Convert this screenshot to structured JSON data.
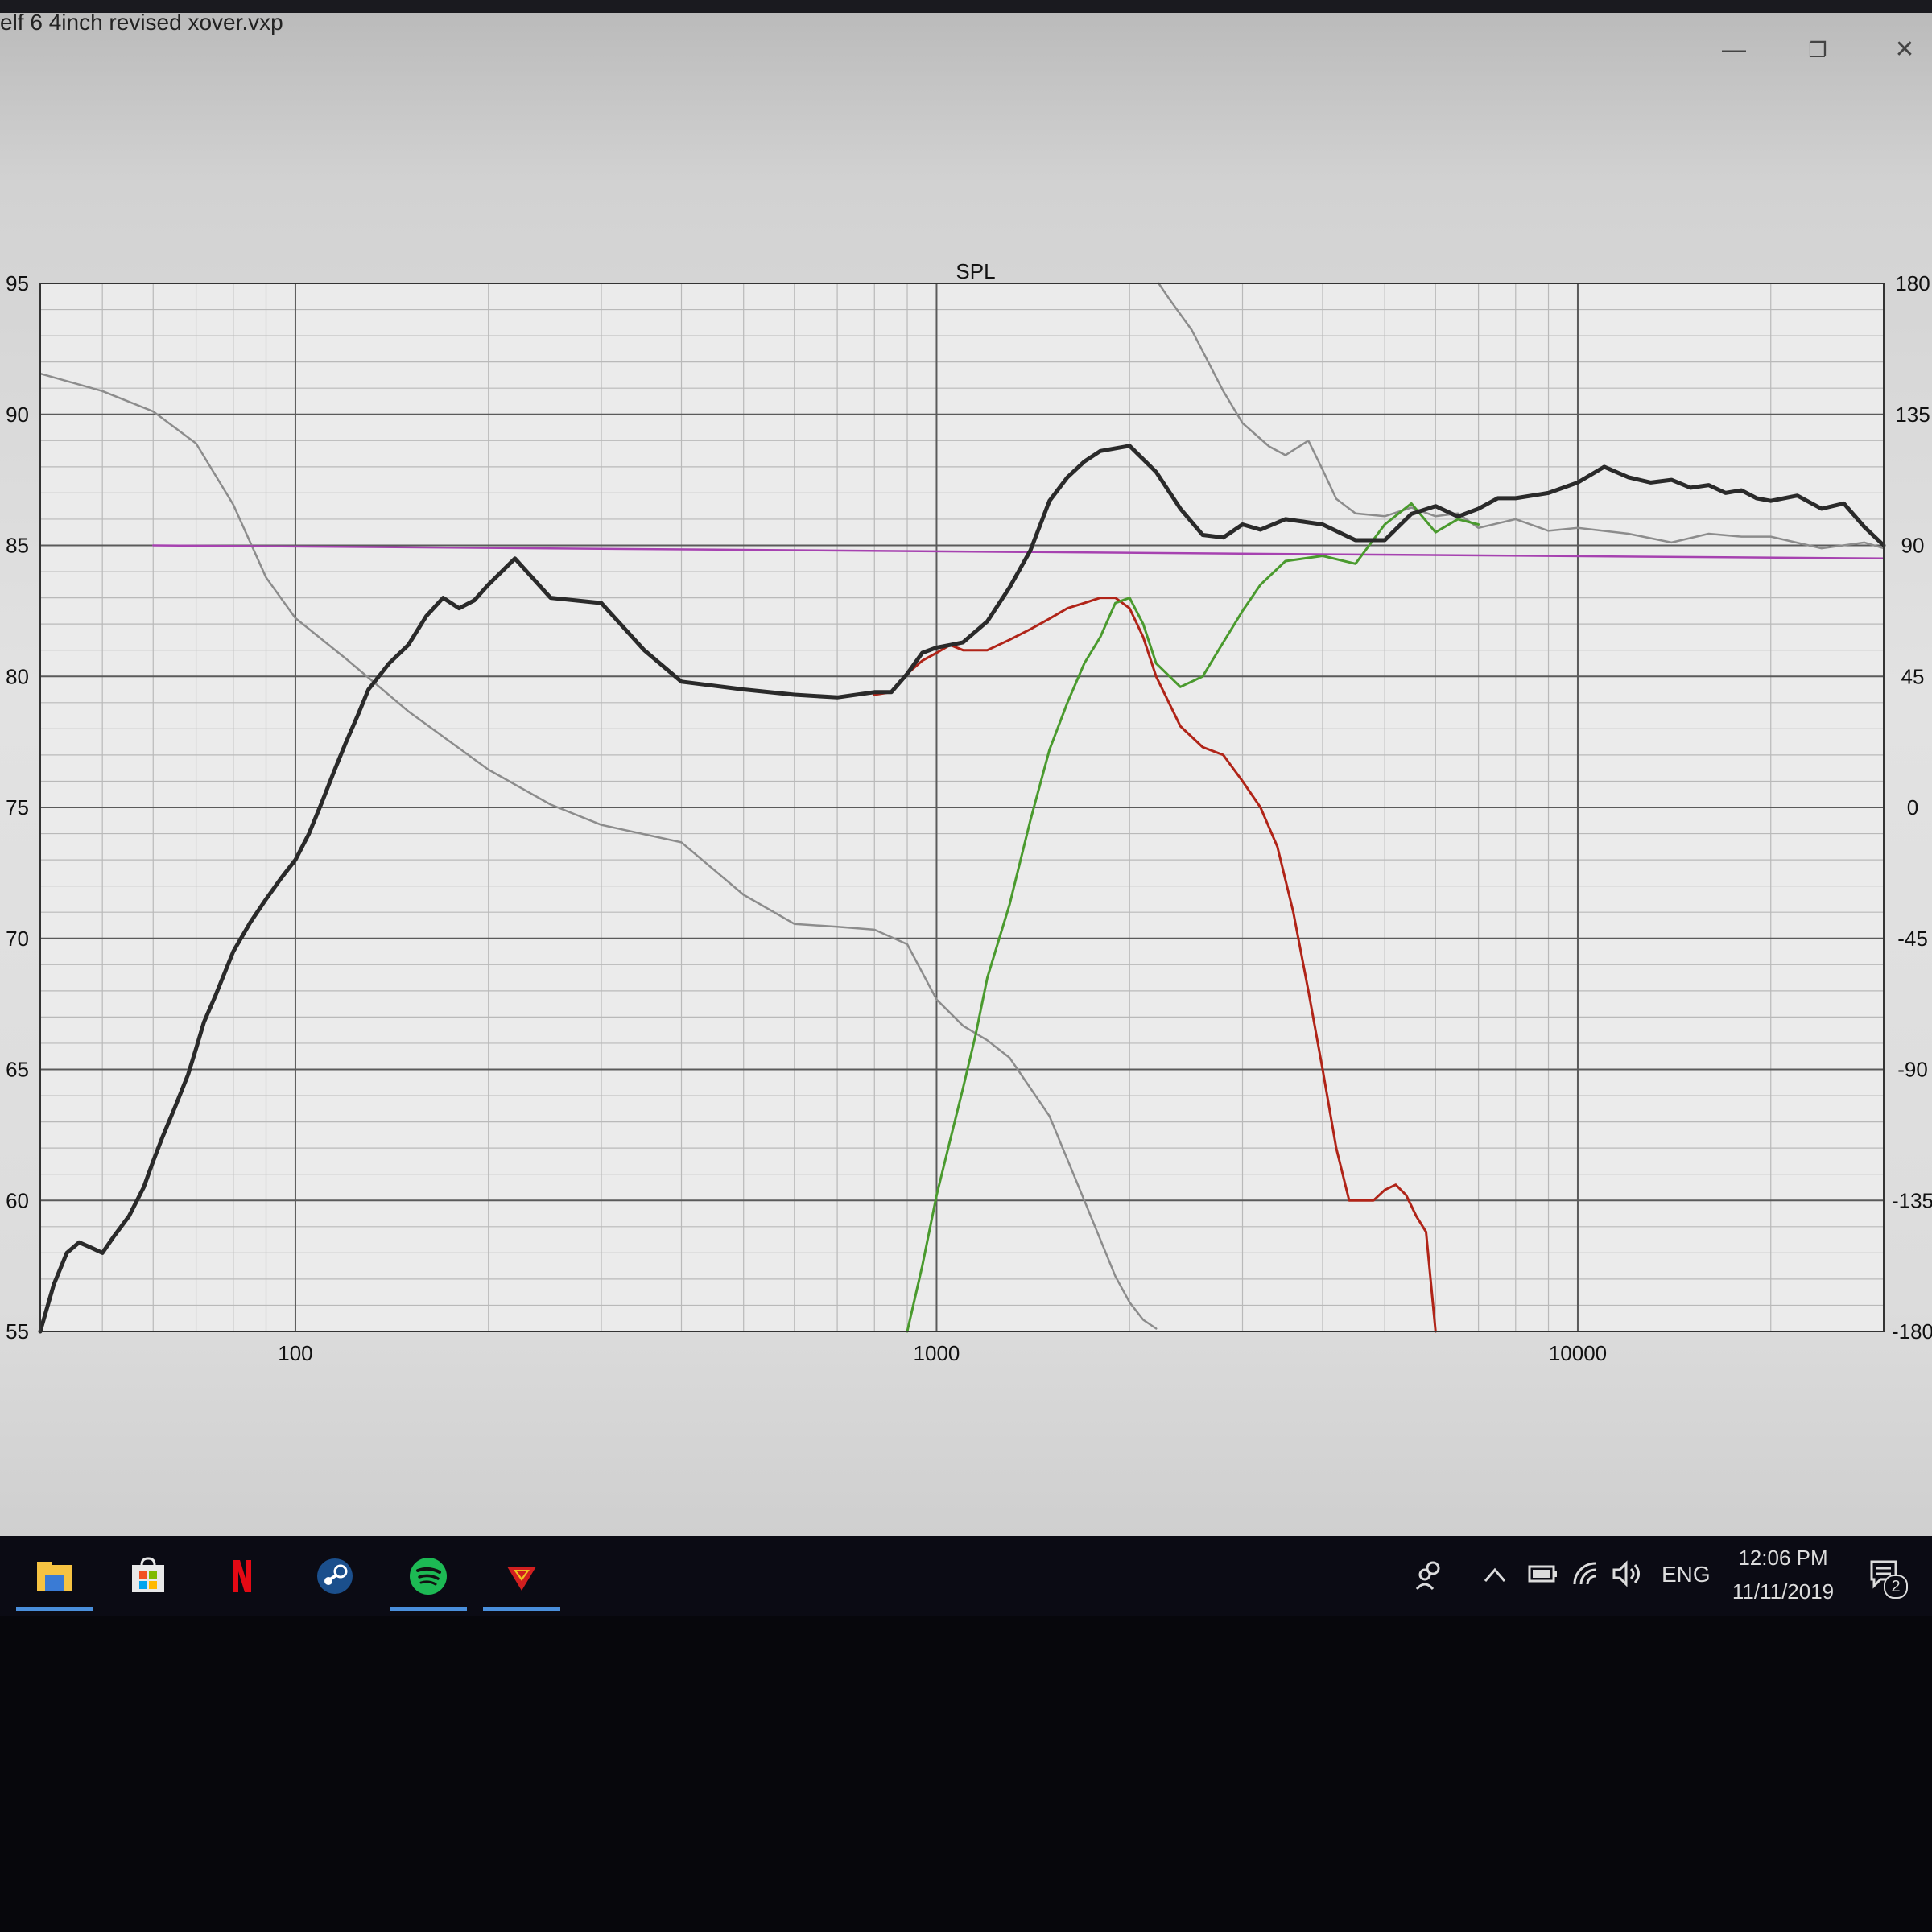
{
  "window": {
    "title": "elf 6 4inch revised xover.vxp",
    "minimize_glyph": "—",
    "restore_glyph": "❐",
    "close_glyph": "✕"
  },
  "chart_data": {
    "type": "line",
    "title": "SPL",
    "xscale": "log",
    "xlim": [
      40,
      30000
    ],
    "ylim": [
      55,
      95
    ],
    "y2lim": [
      -180,
      180
    ],
    "xticks": [
      100,
      1000,
      10000
    ],
    "xtick_labels": [
      "100",
      "1000",
      "10000"
    ],
    "yticks": [
      95,
      90,
      85,
      80,
      75,
      70,
      65,
      60,
      55
    ],
    "y2ticks": [
      180,
      135,
      90,
      45,
      0,
      -45,
      -90,
      -135,
      -180
    ],
    "grid": true,
    "series": [
      {
        "id": "total",
        "color": "#2a2a2a",
        "width": 5,
        "axis": "left",
        "x": [
          40,
          42,
          44,
          46,
          48,
          50,
          52,
          55,
          58,
          60,
          62,
          65,
          68,
          70,
          72,
          75,
          80,
          85,
          90,
          95,
          100,
          105,
          110,
          115,
          120,
          125,
          130,
          140,
          150,
          160,
          170,
          180,
          190,
          200,
          220,
          250,
          300,
          350,
          400,
          500,
          600,
          700,
          800,
          850,
          900,
          950,
          1000,
          1050,
          1100,
          1200,
          1300,
          1400,
          1500,
          1600,
          1700,
          1800,
          2000,
          2200,
          2400,
          2600,
          2800,
          3000,
          3200,
          3500,
          4000,
          4500,
          5000,
          5500,
          6000,
          6500,
          7000,
          7500,
          8000,
          9000,
          10000,
          11000,
          12000,
          13000,
          14000,
          15000,
          16000,
          17000,
          18000,
          19000,
          20000,
          22000,
          24000,
          26000,
          28000,
          30000
        ],
        "y": [
          55,
          56.8,
          58,
          58.4,
          58.2,
          58,
          58.6,
          59.4,
          60.5,
          61.5,
          62.4,
          63.6,
          64.8,
          65.8,
          66.8,
          67.8,
          69.5,
          70.6,
          71.5,
          72.3,
          73,
          74,
          75.2,
          76.4,
          77.5,
          78.5,
          79.5,
          80.5,
          81.2,
          82.3,
          83,
          82.6,
          82.9,
          83.5,
          84.5,
          83,
          82.8,
          81,
          79.8,
          79.5,
          79.3,
          79.2,
          79.4,
          79.4,
          80.1,
          80.9,
          81.1,
          81.2,
          81.3,
          82.1,
          83.4,
          84.8,
          86.7,
          87.6,
          88.2,
          88.6,
          88.8,
          87.8,
          86.4,
          85.4,
          85.3,
          85.8,
          85.6,
          86,
          85.8,
          85.2,
          85.2,
          86.2,
          86.5,
          86.1,
          86.4,
          86.8,
          86.8,
          87,
          87.4,
          88,
          87.6,
          87.4,
          87.5,
          87.2,
          87.3,
          87,
          87.1,
          86.8,
          86.7,
          86.9,
          86.4,
          86.6,
          85.7,
          85
        ]
      },
      {
        "id": "woofer",
        "color": "#b02418",
        "width": 3,
        "axis": "left",
        "x": [
          800,
          850,
          900,
          950,
          1000,
          1050,
          1100,
          1200,
          1300,
          1400,
          1500,
          1600,
          1700,
          1800,
          1900,
          2000,
          2100,
          2200,
          2400,
          2600,
          2800,
          3000,
          3200,
          3400,
          3600,
          3800,
          4000,
          4200,
          4400,
          4600,
          4800,
          5000,
          5200,
          5400,
          5600,
          5800,
          6000
        ],
        "y": [
          79.3,
          79.4,
          80.1,
          80.6,
          80.9,
          81.2,
          81,
          81,
          81.4,
          81.8,
          82.2,
          82.6,
          82.8,
          83,
          83,
          82.6,
          81.5,
          80,
          78.1,
          77.3,
          77,
          76,
          75,
          73.5,
          71,
          68,
          65,
          62,
          60,
          60,
          60,
          60.4,
          60.6,
          60.2,
          59.4,
          58.8,
          55
        ]
      },
      {
        "id": "tweeter",
        "color": "#4a9a2e",
        "width": 3,
        "axis": "left",
        "x": [
          900,
          950,
          1000,
          1050,
          1100,
          1150,
          1200,
          1300,
          1400,
          1500,
          1600,
          1700,
          1800,
          1900,
          2000,
          2100,
          2200,
          2400,
          2600,
          2800,
          3000,
          3200,
          3500,
          4000,
          4500,
          5000,
          5500,
          6000,
          6500,
          7000
        ],
        "y": [
          55,
          57.5,
          60.2,
          62.3,
          64.3,
          66.3,
          68.5,
          71.3,
          74.5,
          77.2,
          79,
          80.5,
          81.5,
          82.8,
          83,
          82,
          80.5,
          79.6,
          80,
          81.3,
          82.5,
          83.5,
          84.4,
          84.6,
          84.3,
          85.8,
          86.6,
          85.5,
          86,
          85.8
        ]
      },
      {
        "id": "phase",
        "color": "#8c8c8c",
        "width": 2.5,
        "axis": "right",
        "x": [
          40,
          50,
          60,
          70,
          80,
          90,
          100,
          120,
          150,
          200,
          250,
          300,
          400,
          500,
          600,
          700,
          800,
          900,
          1000,
          1100,
          1200,
          1300,
          1500,
          1700,
          1900,
          2000,
          2100,
          2200,
          2220,
          2300,
          2500,
          2800,
          3000,
          3300,
          3500,
          3800,
          4000,
          4200,
          4500,
          5000,
          5500,
          6000,
          6500,
          7000,
          8000,
          9000,
          10000,
          12000,
          14000,
          16000,
          18000,
          20000,
          24000,
          28000,
          30000
        ],
        "y": [
          149,
          143,
          136,
          125,
          104,
          79,
          65,
          51,
          33,
          13,
          1,
          -6,
          -12,
          -30,
          -40,
          -41,
          -42,
          -47,
          -66,
          -75,
          -80,
          -86,
          -106,
          -135,
          -161,
          -170,
          -176,
          -179,
          180,
          175,
          164,
          143,
          132,
          124,
          121,
          126,
          116,
          106,
          101,
          100,
          103,
          100,
          101,
          96,
          99,
          95,
          96,
          94,
          91,
          94,
          93,
          93,
          89,
          91,
          89
        ]
      },
      {
        "id": "target",
        "color": "#a642b0",
        "width": 2.5,
        "axis": "left",
        "x": [
          60,
          30000
        ],
        "y": [
          85,
          84.5
        ]
      }
    ]
  },
  "taskbar": {
    "apps": [
      {
        "name": "File Explorer",
        "icon": "folder-icon",
        "color": "#f6c342",
        "active": true
      },
      {
        "name": "Microsoft Store",
        "icon": "store-icon",
        "color": "#dcdcdc",
        "active": false
      },
      {
        "name": "Netflix",
        "icon": "netflix-icon",
        "color": "#e50914",
        "active": false
      },
      {
        "name": "Steam",
        "icon": "steam-icon",
        "color": "#1b4f8c",
        "active": false
      },
      {
        "name": "Spotify",
        "icon": "spotify-icon",
        "color": "#1db954",
        "active": true
      },
      {
        "name": "VituixCAD",
        "icon": "vituixcad-icon",
        "color": "#d11f1f",
        "active": true
      }
    ],
    "tray": {
      "language": "ENG",
      "time": "12:06 PM",
      "date": "11/11/2019",
      "notification_count": "2"
    }
  }
}
